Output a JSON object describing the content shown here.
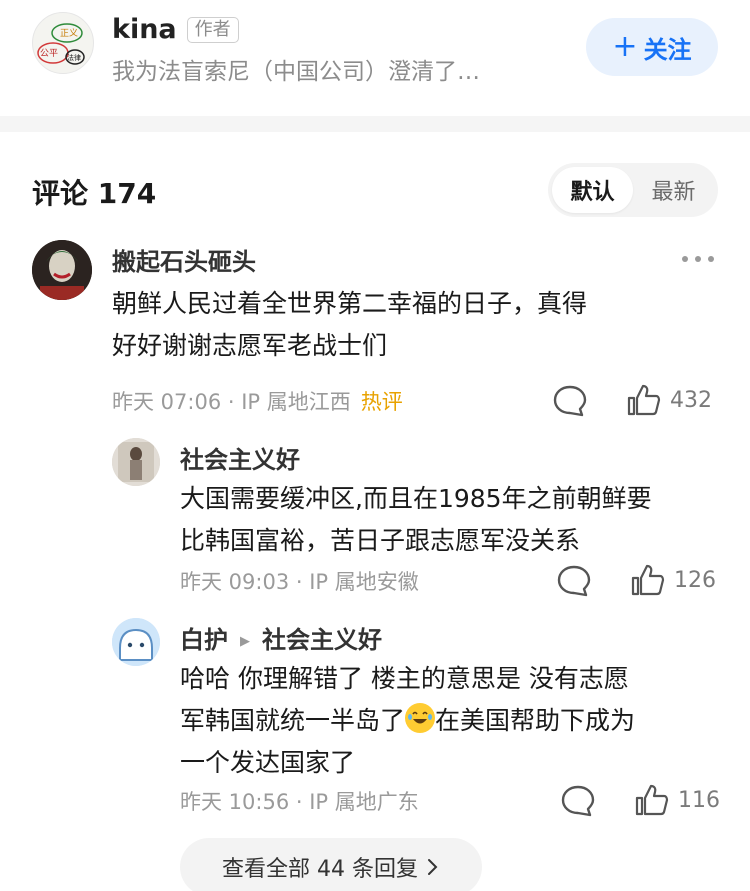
{
  "author": {
    "name": "kina",
    "tag": "作者",
    "description": "我为法盲索尼（中国公司）澄清了…",
    "follow_label": "关注",
    "avatar_words": [
      "正义",
      "公平",
      "法律"
    ]
  },
  "comments_header": {
    "title": "评论 174",
    "sort_default": "默认",
    "sort_latest": "最新"
  },
  "comments": [
    {
      "user": "搬起石头砸头",
      "lines": [
        "朝鲜人民过着全世界第二幸福的日子，真得",
        "好好谢谢志愿军老战士们"
      ],
      "time": "昨天 07:06 · IP 属地江西",
      "badge": "热评",
      "likes": "432"
    }
  ],
  "replies": [
    {
      "user": "社会主义好",
      "lines": [
        "大国需要缓冲区,而且在1985年之前朝鲜要",
        "比韩国富裕，苦日子跟志愿军没关系"
      ],
      "time": "昨天 09:03 · IP 属地安徽",
      "likes": "126"
    },
    {
      "user": "白护",
      "reply_to": "社会主义好",
      "line1": "哈哈  你理解错了 楼主的意思是 没有志愿",
      "line2a": "军韩国就统一半岛了",
      "line2b": "在美国帮助下成为",
      "line3": "一个发达国家了",
      "emoji": "laughing-with-tears-emoji",
      "time": "昨天 10:56 · IP 属地广东",
      "likes": "116"
    }
  ],
  "view_all_label": "查看全部 44 条回复",
  "colors": {
    "accent_blue": "#1772f6",
    "follow_bg": "#e8f1fd",
    "hot_badge": "#e8a200",
    "meta_gray": "#9a9a9a"
  }
}
